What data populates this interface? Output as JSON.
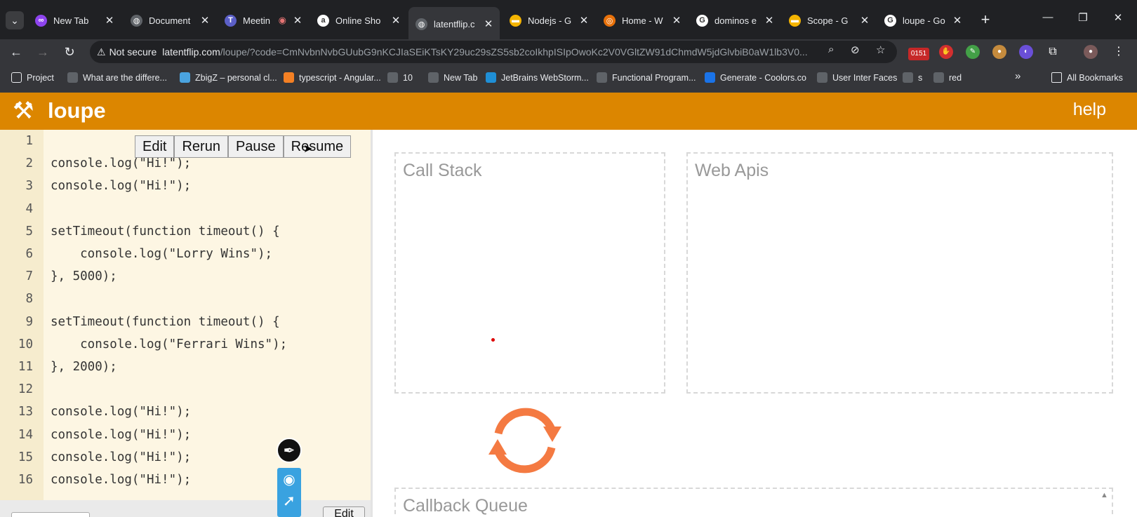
{
  "browser": {
    "tabs": [
      {
        "title": "New Tab",
        "favicon": "chrome-new-tab-icon",
        "color": "#8e44ef",
        "glyph": "∞"
      },
      {
        "title": "Document",
        "favicon": "globe-icon",
        "color": "#5f6368",
        "glyph": "◍"
      },
      {
        "title": "Meetin",
        "favicon": "teams-icon",
        "color": "#5b5fc7",
        "glyph": "T",
        "recording": "◉"
      },
      {
        "title": "Online Sho",
        "favicon": "amazon-icon",
        "color": "#ffffff",
        "glyph": "a"
      },
      {
        "title": "latentflip.c",
        "favicon": "globe-icon",
        "color": "#5f6368",
        "glyph": "◍",
        "active": true
      },
      {
        "title": "Nodejs - G",
        "favicon": "slides-icon",
        "color": "#f4b400",
        "glyph": "▬"
      },
      {
        "title": "Home - W",
        "favicon": "orange-circle-icon",
        "color": "#e8710a",
        "glyph": "◎"
      },
      {
        "title": "dominos e",
        "favicon": "google-icon",
        "color": "#ffffff",
        "glyph": "G"
      },
      {
        "title": "Scope - G",
        "favicon": "slides-icon",
        "color": "#f4b400",
        "glyph": "▬"
      },
      {
        "title": "loupe - Go",
        "favicon": "google-icon",
        "color": "#ffffff",
        "glyph": "G"
      }
    ],
    "new_tab": "+",
    "window_controls": {
      "minimize": "—",
      "restore": "❐",
      "close": "✕"
    },
    "address": {
      "security": "Not secure",
      "host": "latentflip.com",
      "path": "/loupe/?code=CmNvbnNvbGUubG9nKCJIaSEiKTsKY29uc29sZS5sb2coIkhpISIpOwoKc2V0VGltZW91dChmdW5jdGlvbiB0aW1lb3V0..."
    },
    "extension_badge": "0151",
    "bookmarks": [
      {
        "label": "Project",
        "icon": "folder-icon"
      },
      {
        "label": "What are the differe...",
        "icon": "bookmark-icon"
      },
      {
        "label": "ZbigZ – personal cl...",
        "icon": "cloud-icon"
      },
      {
        "label": "typescript - Angular...",
        "icon": "stackoverflow-icon"
      },
      {
        "label": "10",
        "icon": "bookmark-icon"
      },
      {
        "label": "New Tab",
        "icon": "bookmark-icon"
      },
      {
        "label": "JetBrains WebStorm...",
        "icon": "jetbrains-icon"
      },
      {
        "label": "Functional Program...",
        "icon": "bookmark-icon"
      },
      {
        "label": "Generate - Coolors.co",
        "icon": "coolors-icon"
      },
      {
        "label": "User Inter Faces",
        "icon": "bookmark-icon"
      },
      {
        "label": "s",
        "icon": "bookmark-icon"
      },
      {
        "label": "red",
        "icon": "bookmark-icon"
      }
    ],
    "bookmarks_overflow": "»",
    "all_bookmarks": "All Bookmarks"
  },
  "app": {
    "title": "loupe",
    "logo_glyph": "⚒",
    "help": "help",
    "accent": "#dc8600",
    "controls": {
      "edit": "Edit",
      "rerun": "Rerun",
      "pause": "Pause",
      "resume": "Resume"
    },
    "bottom_edit": "Edit",
    "code_lines": [
      {
        "n": "1",
        "code": ""
      },
      {
        "n": "2",
        "code": "console.log(\"Hi!\");"
      },
      {
        "n": "3",
        "code": "console.log(\"Hi!\");"
      },
      {
        "n": "4",
        "code": ""
      },
      {
        "n": "5",
        "code": "setTimeout(function timeout() {"
      },
      {
        "n": "6",
        "code": "    console.log(\"Lorry Wins\");"
      },
      {
        "n": "7",
        "code": "}, 5000);"
      },
      {
        "n": "8",
        "code": ""
      },
      {
        "n": "9",
        "code": "setTimeout(function timeout() {"
      },
      {
        "n": "10",
        "code": "    console.log(\"Ferrari Wins\");"
      },
      {
        "n": "11",
        "code": "}, 2000);"
      },
      {
        "n": "12",
        "code": ""
      },
      {
        "n": "13",
        "code": "console.log(\"Hi!\");"
      },
      {
        "n": "14",
        "code": "console.log(\"Hi!\");"
      },
      {
        "n": "15",
        "code": "console.log(\"Hi!\");"
      },
      {
        "n": "16",
        "code": "console.log(\"Hi!\");"
      }
    ],
    "panels": {
      "call_stack": "Call Stack",
      "web_apis": "Web Apis",
      "callback_queue": "Callback Queue"
    },
    "loop_color": "#f47a42"
  }
}
